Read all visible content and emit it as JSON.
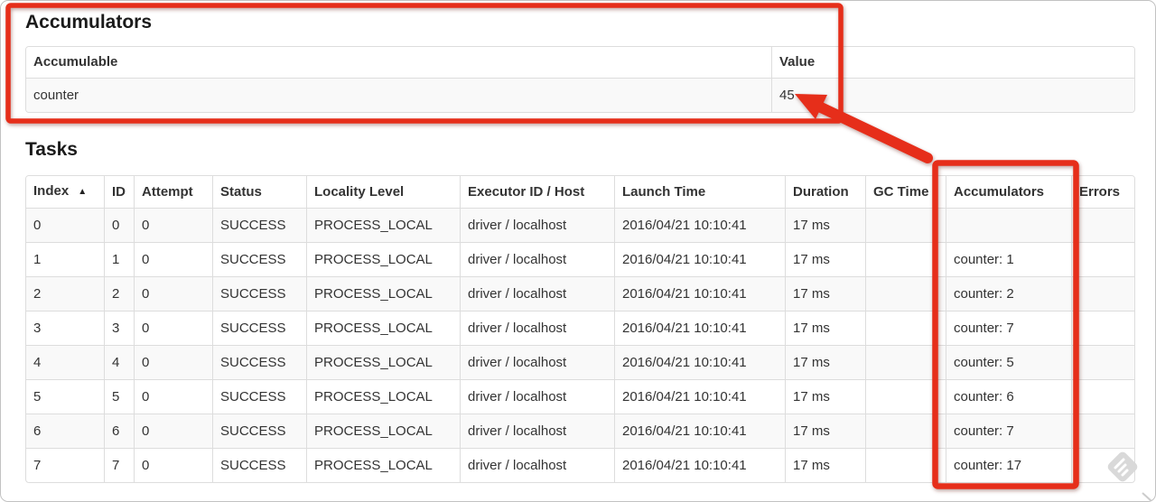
{
  "accumulators": {
    "heading": "Accumulators",
    "table": {
      "headers": [
        "Accumulable",
        "Value"
      ],
      "rows": [
        [
          "counter",
          "45"
        ]
      ]
    }
  },
  "tasks": {
    "heading": "Tasks",
    "sort": {
      "column": "Index",
      "direction": "ascending",
      "icon": "▲"
    },
    "table": {
      "headers": [
        "Index",
        "ID",
        "Attempt",
        "Status",
        "Locality Level",
        "Executor ID / Host",
        "Launch Time",
        "Duration",
        "GC Time",
        "Accumulators",
        "Errors"
      ],
      "rows": [
        [
          "0",
          "0",
          "0",
          "SUCCESS",
          "PROCESS_LOCAL",
          "driver / localhost",
          "2016/04/21 10:10:41",
          "17 ms",
          "",
          "",
          ""
        ],
        [
          "1",
          "1",
          "0",
          "SUCCESS",
          "PROCESS_LOCAL",
          "driver / localhost",
          "2016/04/21 10:10:41",
          "17 ms",
          "",
          "counter: 1",
          ""
        ],
        [
          "2",
          "2",
          "0",
          "SUCCESS",
          "PROCESS_LOCAL",
          "driver / localhost",
          "2016/04/21 10:10:41",
          "17 ms",
          "",
          "counter: 2",
          ""
        ],
        [
          "3",
          "3",
          "0",
          "SUCCESS",
          "PROCESS_LOCAL",
          "driver / localhost",
          "2016/04/21 10:10:41",
          "17 ms",
          "",
          "counter: 7",
          ""
        ],
        [
          "4",
          "4",
          "0",
          "SUCCESS",
          "PROCESS_LOCAL",
          "driver / localhost",
          "2016/04/21 10:10:41",
          "17 ms",
          "",
          "counter: 5",
          ""
        ],
        [
          "5",
          "5",
          "0",
          "SUCCESS",
          "PROCESS_LOCAL",
          "driver / localhost",
          "2016/04/21 10:10:41",
          "17 ms",
          "",
          "counter: 6",
          ""
        ],
        [
          "6",
          "6",
          "0",
          "SUCCESS",
          "PROCESS_LOCAL",
          "driver / localhost",
          "2016/04/21 10:10:41",
          "17 ms",
          "",
          "counter: 7",
          ""
        ],
        [
          "7",
          "7",
          "0",
          "SUCCESS",
          "PROCESS_LOCAL",
          "driver / localhost",
          "2016/04/21 10:10:41",
          "17 ms",
          "",
          "counter: 17",
          ""
        ]
      ]
    }
  },
  "annotations": {
    "color": "#e62e1a",
    "items": [
      "accumulators-section-box",
      "accumulators-column-box",
      "arrow-to-value"
    ]
  },
  "watermark": {
    "icon": "diamond-stripes-icon",
    "color": "#d9d9d9"
  },
  "colors": {
    "table_border": "#dddddd",
    "stripe_row": "#f9f9f9",
    "text": "#333333",
    "heading": "#1b1b1b"
  }
}
